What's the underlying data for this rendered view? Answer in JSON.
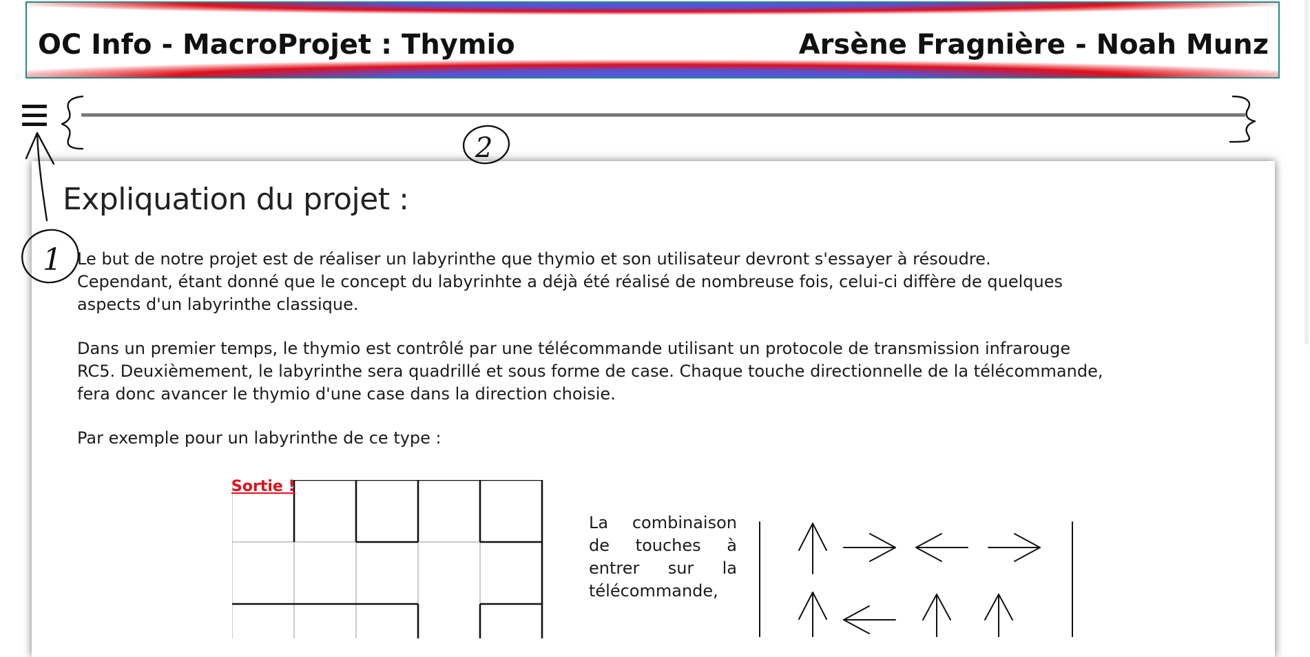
{
  "header": {
    "title": "OC Info - MacroProjet : Thymio",
    "authors": "Arsène Fragnière - Noah Munz"
  },
  "content": {
    "heading": "Expliquation du projet :",
    "paragraphs": {
      "p1_line1": "Le but de notre projet est de réaliser un labyrinthe que thymio et son utilisateur devront s'essayer à résoudre.",
      "p1_line2": "Cependant, étant donné que le concept du labyrinhte a déjà été réalisé de nombreuse fois, celui-ci diffère de quelques",
      "p1_line3": "aspects d'un labyrinthe classique.",
      "p2_line1": "Dans un premier temps, le thymio est contrôlé par une télécommande utilisant un protocole de transmission infrarouge",
      "p2_line2": "RC5. Deuxièmement, le labyrinthe sera quadrillé et sous forme de case. Chaque touche directionnelle de la télécommande,",
      "p2_line3": "fera donc avancer le thymio d'une case dans la direction choisie.",
      "p3": "Par exemple pour un labyrinthe de ce type :"
    },
    "maze": {
      "exit_label": "Sortie !"
    },
    "combination_text": "La combinaison de touches à entrer sur la télécommande,"
  },
  "annotations": {
    "mark_1": "1",
    "mark_2": "2"
  },
  "icons": [
    "menu-icon",
    "arrow-up-icon",
    "arrow-right-icon",
    "arrow-left-icon"
  ],
  "colors": {
    "accent_red": "#e0101a",
    "accent_blue": "#4f5fd8",
    "border_teal": "#1f8a86"
  }
}
